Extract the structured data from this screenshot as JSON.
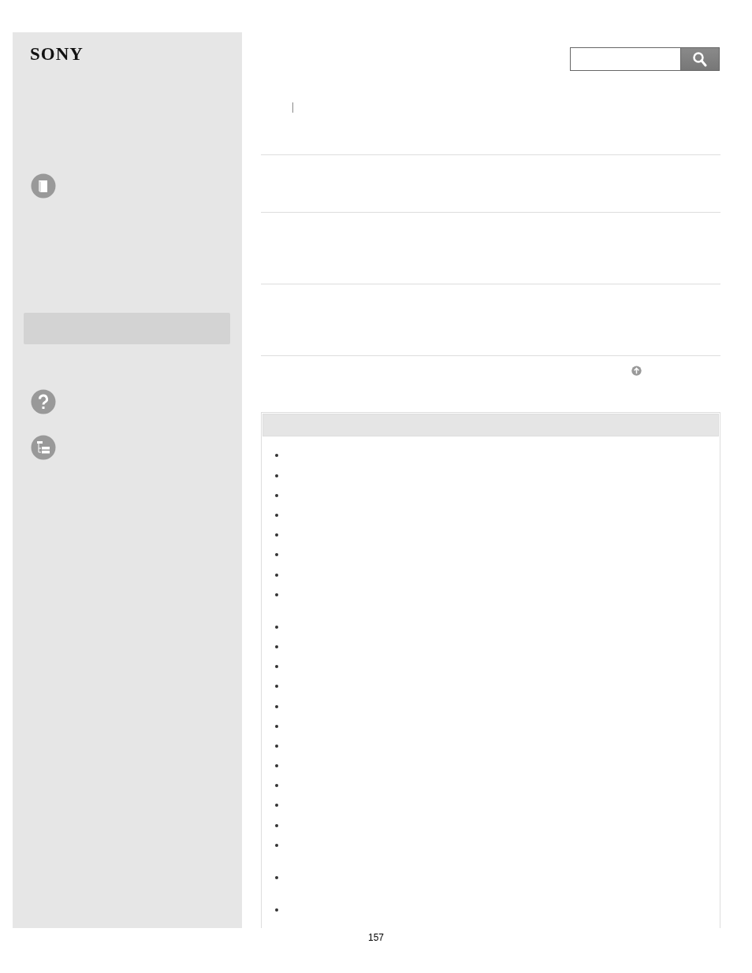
{
  "logo": "SONY",
  "list_items": [
    {
      "kind": "single"
    },
    {
      "kind": "single"
    },
    {
      "kind": "single"
    },
    {
      "kind": "single"
    },
    {
      "kind": "single"
    },
    {
      "kind": "single"
    },
    {
      "kind": "single"
    },
    {
      "kind": "double"
    },
    {
      "kind": "single"
    },
    {
      "kind": "single"
    },
    {
      "kind": "single"
    },
    {
      "kind": "single"
    },
    {
      "kind": "single"
    },
    {
      "kind": "single"
    },
    {
      "kind": "single"
    },
    {
      "kind": "single"
    },
    {
      "kind": "single"
    },
    {
      "kind": "single"
    },
    {
      "kind": "single"
    },
    {
      "kind": "double"
    },
    {
      "kind": "double"
    },
    {
      "kind": "single"
    }
  ],
  "page_number": "157"
}
